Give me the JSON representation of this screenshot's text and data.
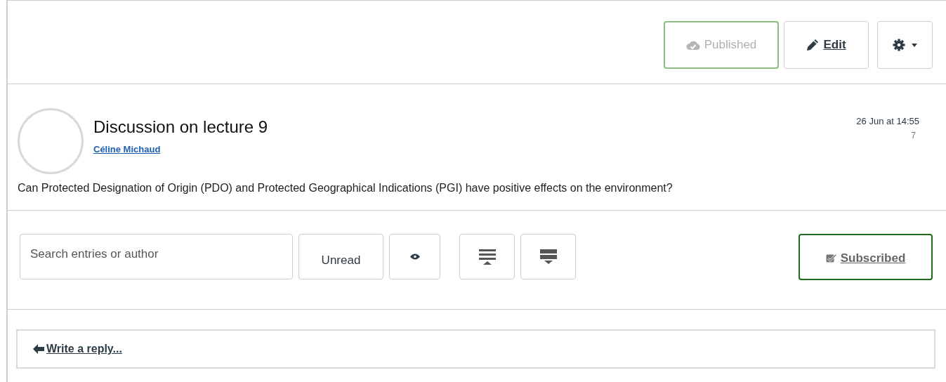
{
  "header": {
    "published": {
      "label": "Published",
      "on": true
    },
    "edit": {
      "label": "Edit"
    }
  },
  "post": {
    "title": "Discussion on lecture 9",
    "author": "Céline Michaud",
    "date": "26 Jun at 14:55",
    "count": "7",
    "body": "Can Protected Designation of Origin (PDO) and Protected Geographical Indications (PGI) have positive effects on the environment?"
  },
  "toolbar": {
    "search": {
      "placeholder": "Search entries or author"
    },
    "unread": {
      "label": "Unread"
    },
    "subscribe": {
      "label": "Subscribed",
      "on": true
    }
  },
  "reply": {
    "label": "Write a reply..."
  }
}
